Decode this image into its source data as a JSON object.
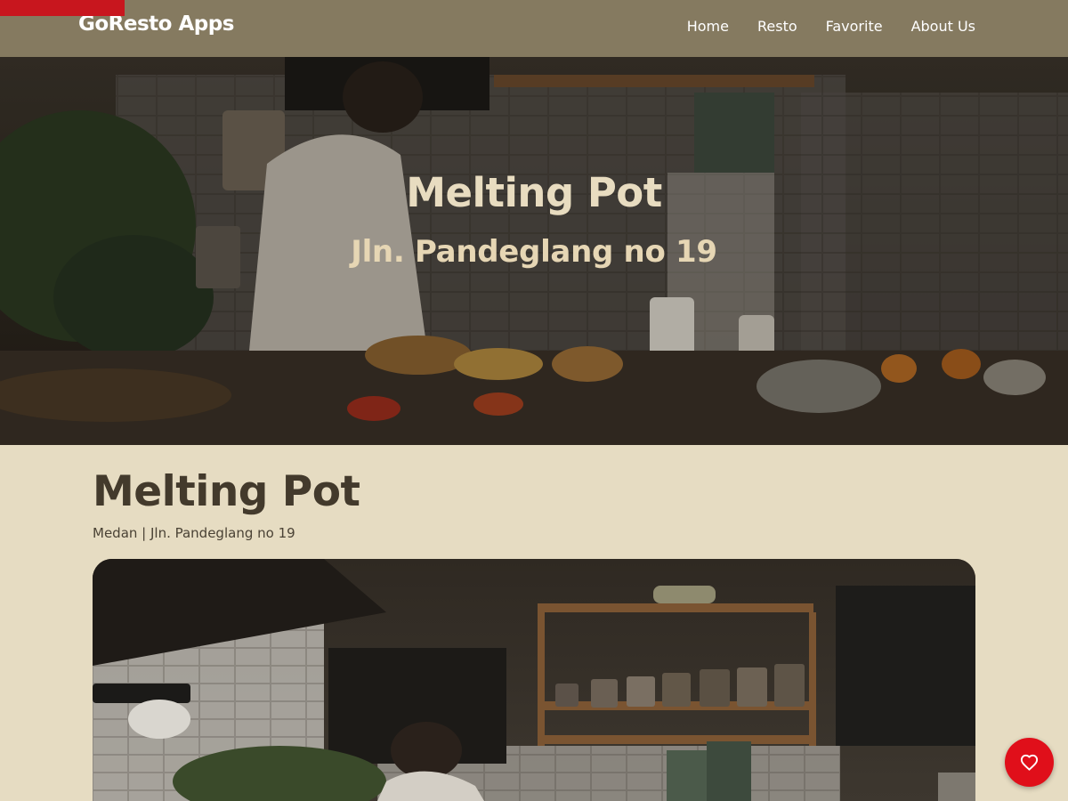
{
  "app": {
    "brand": "GoResto Apps"
  },
  "nav": {
    "items": [
      {
        "label": "Home"
      },
      {
        "label": "Resto"
      },
      {
        "label": "Favorite"
      },
      {
        "label": "About Us"
      }
    ]
  },
  "hero": {
    "title": "Melting Pot",
    "subtitle": "Jln. Pandeglang no 19"
  },
  "restaurant": {
    "name": "Melting Pot",
    "location": "Medan | Jln. Pandeglang no 19"
  },
  "icons": {
    "favorite": "heart-outline-icon"
  },
  "colors": {
    "navbar": "#857a60",
    "page_background": "#e6dcc2",
    "accent": "#e00f1a",
    "title_text": "#433a2c"
  }
}
